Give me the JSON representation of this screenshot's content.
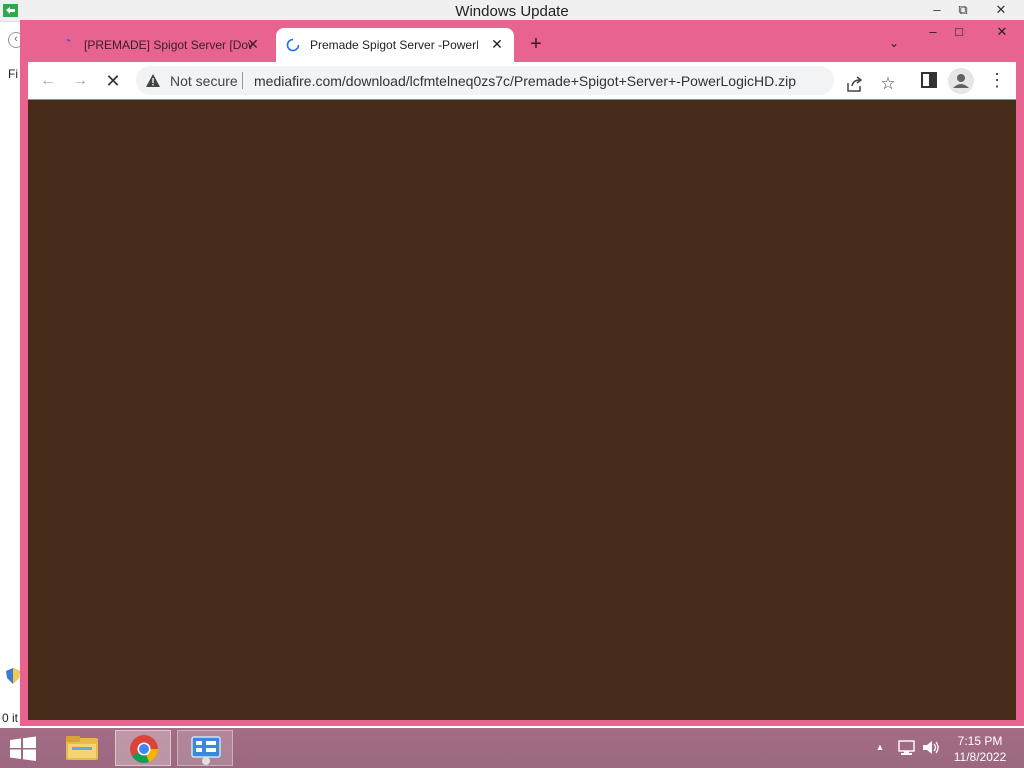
{
  "background_window": {
    "title": "Windows Update",
    "menu_first_item": "Fi",
    "status_text": "0 it"
  },
  "browser": {
    "tabs": [
      {
        "label": "[PREMADE] Spigot Server [Download]",
        "active": false
      },
      {
        "label": "Premade Spigot Server -PowerLogicHD",
        "active": true
      }
    ],
    "toolbar": {
      "security_label": "Not secure",
      "url": "mediafire.com/download/lcfmtelneq0zs7c/Premade+Spigot+Server+-PowerLogicHD.zip"
    },
    "page_background_color": "#472b19",
    "frame_color": "#e8638f"
  },
  "taskbar": {
    "apps": [
      "file-explorer",
      "google-chrome",
      "control-panel"
    ],
    "clock": {
      "time": "7:15 PM",
      "date": "11/8/2022"
    }
  }
}
